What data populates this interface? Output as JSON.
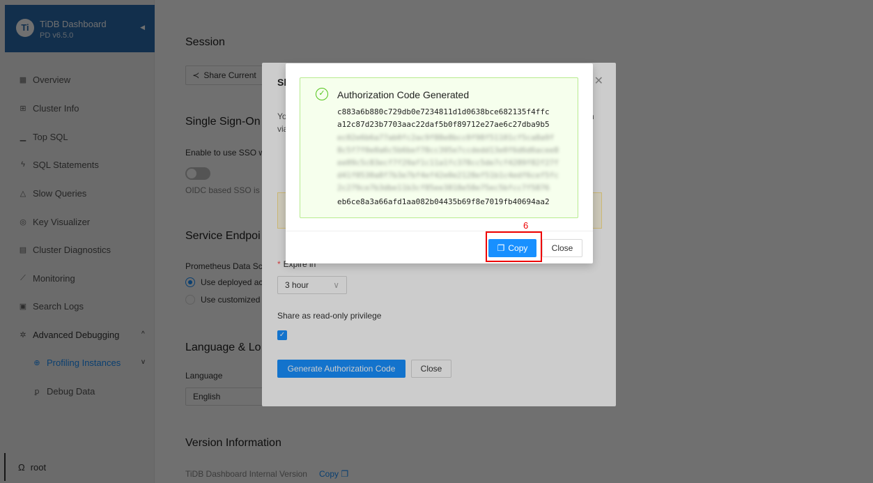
{
  "sidebar": {
    "brand_title": "TiDB Dashboard",
    "brand_version": "PD v6.5.0",
    "items": [
      {
        "label": "Overview",
        "icon": "grid-icon"
      },
      {
        "label": "Cluster Info",
        "icon": "cluster-icon"
      },
      {
        "label": "Top SQL",
        "icon": "chart-icon"
      },
      {
        "label": "SQL Statements",
        "icon": "thunder-icon"
      },
      {
        "label": "Slow Queries",
        "icon": "bell-icon"
      },
      {
        "label": "Key Visualizer",
        "icon": "eye-icon"
      },
      {
        "label": "Cluster Diagnostics",
        "icon": "doc-icon"
      },
      {
        "label": "Monitoring",
        "icon": "line-chart-icon"
      },
      {
        "label": "Search Logs",
        "icon": "search-doc-icon"
      },
      {
        "label": "Advanced Debugging",
        "icon": "bug-icon"
      },
      {
        "label": "Profiling Instances",
        "icon": "target-icon"
      },
      {
        "label": "Debug Data",
        "icon": "key-icon"
      }
    ],
    "user": "root"
  },
  "page": {
    "session_title": "Session",
    "share_button": "Share Current",
    "sso_title": "Single Sign-On",
    "sso_label": "Enable to use SSO w",
    "sso_note": "OIDC based SSO is",
    "endpoint_title": "Service Endpoi",
    "prometheus_label": "Prometheus Data Sc",
    "radio_deployed": "Use deployed ac",
    "radio_custom": "Use customized",
    "lang_title": "Language & Lo",
    "lang_label": "Language",
    "lang_value": "English",
    "version_title": "Version Information",
    "version_label": "TiDB Dashboard Internal Version",
    "version_copy": "Copy"
  },
  "share_modal": {
    "title": "Sh",
    "desc_line1": "Yo",
    "desc_line2": "via",
    "desc_tail": "n",
    "expire_label": "Expire in",
    "expire_value": "3 hour",
    "readonly_label": "Share as read-only privilege",
    "generate_button": "Generate Authorization Code",
    "close_button": "Close"
  },
  "auth_modal": {
    "title": "Authorization Code Generated",
    "code_lines": [
      "c883a6b880c729db0e7234811d1d0638bce682135f4ffc",
      "a12c87d23b7703aac22daf5b0f89712e27ae6c27dba9b5",
      "ec02e6b6a77ab0fc2ac9f88e8bcc0f98f51101cf5ca8a9f",
      "8c5f7f0e0a6c5b6bef78cc395e7ccdedd13e0f6d6d6acee8",
      "ee09c5c83ecf7f29af1c11a1fc378cc5de7cf4289f82f27f",
      "d41f0530a8f7b3e7bf4ef42e0e2128ef51b1c4edf6cef5fc",
      "2c279ce7b3dbe11b3cf85ee3818e58e75ec5bfcc7f5876",
      "eb6ce8a3a66afd1aa082b04435b69f8e7019fb40694aa2"
    ],
    "blurred_from": 2,
    "blurred_to": 6,
    "copy_button": "Copy",
    "close_button": "Close"
  },
  "annotation": {
    "number": "6",
    "color": "#ee0000"
  }
}
